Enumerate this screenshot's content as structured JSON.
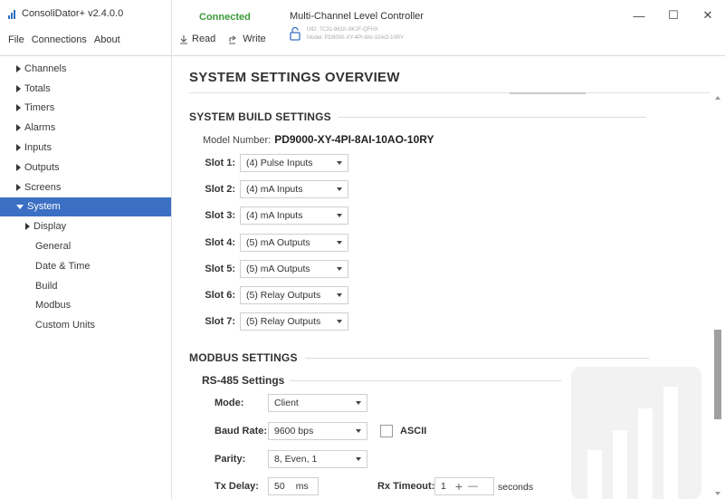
{
  "app": {
    "title": "ConsoliDator+ v2.4.0.0",
    "menu": [
      "File",
      "Connections",
      "About"
    ]
  },
  "connection": {
    "status": "Connected",
    "read_label": "Read",
    "write_label": "Write",
    "device_title": "Multi-Channel Level Controller",
    "device_uid": "UID: 7C31-961K-9KJF-QFHX",
    "device_model": "Model: PD9000-XY-4PI-8AI-10AO-10RY",
    "status_color": "#3a9a3a"
  },
  "window_controls": {
    "minimize": "—",
    "maximize": "☐",
    "close": "✕"
  },
  "sidebar": {
    "items": [
      {
        "label": "Channels"
      },
      {
        "label": "Totals"
      },
      {
        "label": "Timers"
      },
      {
        "label": "Alarms"
      },
      {
        "label": "Inputs"
      },
      {
        "label": "Outputs"
      },
      {
        "label": "Screens"
      },
      {
        "label": "System"
      },
      {
        "label": "Display"
      },
      {
        "label": "General"
      },
      {
        "label": "Date & Time"
      },
      {
        "label": "Build"
      },
      {
        "label": "Modbus"
      },
      {
        "label": "Custom Units"
      }
    ],
    "active_color": "#3b6fc4"
  },
  "main": {
    "page_title": "SYSTEM SETTINGS OVERVIEW",
    "build": {
      "heading": "SYSTEM BUILD SETTINGS",
      "model_label": "Model Number:",
      "model_value": "PD9000-XY-4PI-8AI-10AO-10RY",
      "slots": [
        {
          "label": "Slot 1:",
          "value": "(4) Pulse Inputs"
        },
        {
          "label": "Slot 2:",
          "value": "(4) mA Inputs"
        },
        {
          "label": "Slot 3:",
          "value": "(4) mA Inputs"
        },
        {
          "label": "Slot 4:",
          "value": "(5) mA Outputs"
        },
        {
          "label": "Slot 5:",
          "value": "(5) mA Outputs"
        },
        {
          "label": "Slot 6:",
          "value": "(5) Relay Outputs"
        },
        {
          "label": "Slot 7:",
          "value": "(5) Relay Outputs"
        }
      ]
    },
    "modbus": {
      "heading": "MODBUS SETTINGS",
      "rs485_heading": "RS-485 Settings",
      "mode_label": "Mode:",
      "mode_value": "Client",
      "baud_label": "Baud Rate:",
      "baud_value": "9600 bps",
      "ascii_label": "ASCII",
      "ascii_checked": false,
      "parity_label": "Parity:",
      "parity_value": "8, Even, 1",
      "txdelay_label": "Tx Delay:",
      "txdelay_value": "50",
      "txdelay_unit": "ms",
      "rxtimeout_label": "Rx Timeout:",
      "rxtimeout_value": "1",
      "rxtimeout_unit": "seconds",
      "plus": "+",
      "minus": "—"
    }
  }
}
